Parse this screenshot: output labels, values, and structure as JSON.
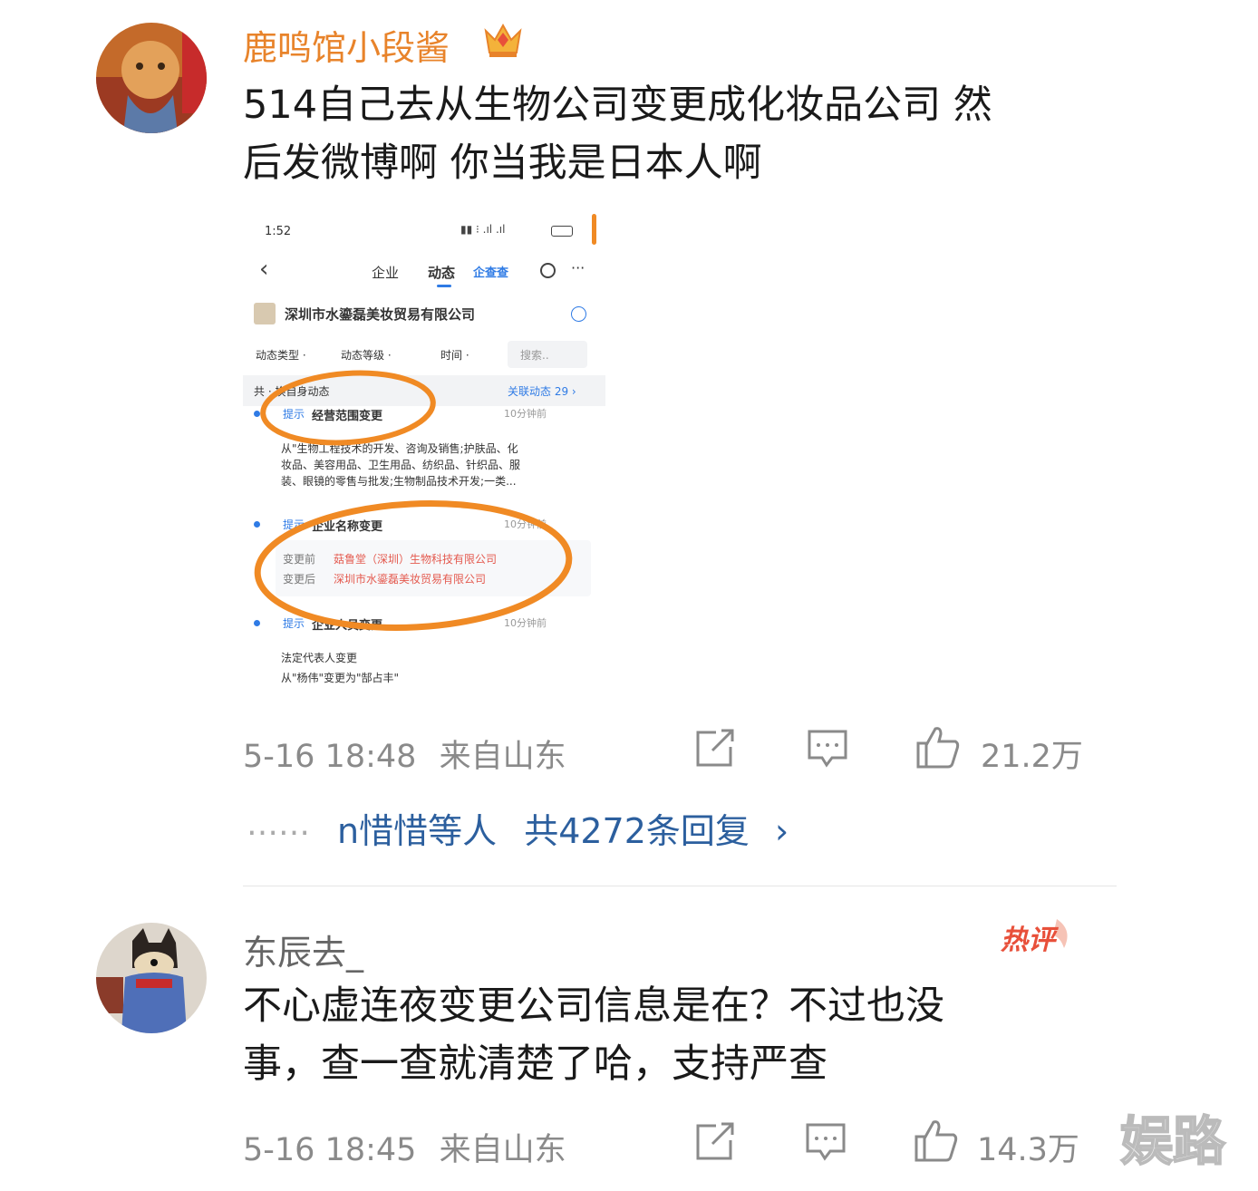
{
  "comments": [
    {
      "username": "鹿鸣馆小段酱",
      "text_line1": "514自己去从生物公司变更成化妆品公司 然",
      "text_line2": "后发微博啊 你当我是日本人啊",
      "date": "5-16 18:48",
      "location": "来自山东",
      "likes": "21.2万",
      "replies_names": "n惜惜等人",
      "replies_count": "共4272条回复",
      "replies_chevron": "›",
      "replies_dots": "……"
    },
    {
      "username": "东辰去_",
      "badge": "热评",
      "text_line1": "不心虚连夜变更公司信息是在？不过也没",
      "text_line2": "事，查一查就清楚了哈，支持严查",
      "date": "5-16 18:45",
      "location": "来自山东",
      "likes": "14.3万"
    }
  ],
  "embedded_screenshot": {
    "status_time": "1:52",
    "tabs": [
      "企业",
      "动态",
      "企查查"
    ],
    "back": "‹",
    "more": "···",
    "company_name": "深圳市水鎏磊美妆贸易有限公司",
    "filters": [
      "动态类型 ·",
      "动态等级 ·",
      "时间 ·"
    ],
    "search_placeholder": "搜索..",
    "own_dynamics": "共 · 换自身动态",
    "related": "关联动态 29 ›",
    "items": [
      {
        "tag": "提示",
        "title": "经营范围变更",
        "time": "10分钟前",
        "body1": "从\"生物工程技术的开发、咨询及销售;护肤品、化",
        "body2": "妆品、美容用品、卫生用品、纺织品、针织品、服",
        "body3": "装、眼镜的零售与批发;生物制品技术开发;一类..."
      },
      {
        "tag": "提示",
        "title": "企业名称变更",
        "time": "10分钟前",
        "before_label": "变更前",
        "before_value": "菇鲁堂（深圳）生物科技有限公司",
        "after_label": "变更后",
        "after_value": "深圳市水鎏磊美妆贸易有限公司"
      },
      {
        "tag": "提示",
        "title": "企业人员变更",
        "time": "10分钟前",
        "body1": "法定代表人变更",
        "body2": "从\"杨伟\"变更为\"郜占丰\""
      }
    ]
  },
  "watermark": "娱路",
  "colors": {
    "username_orange": "#e8832a",
    "username_gray": "#666666",
    "link_blue": "#2c5f9e",
    "meta_gray": "#8a8a8a",
    "hot_red": "#e8503a",
    "highlight_orange": "#f08a24"
  }
}
